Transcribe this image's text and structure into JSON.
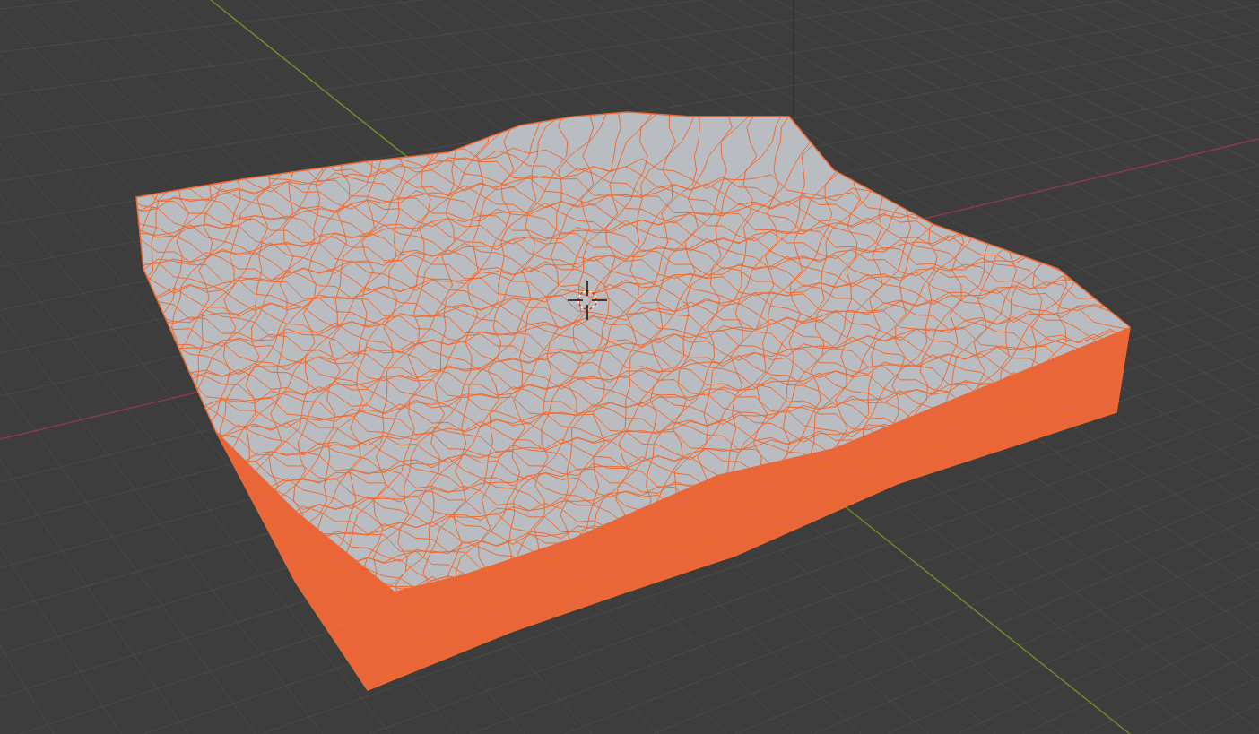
{
  "viewport": {
    "mesh": {
      "selected": true
    },
    "cursor_visible": true
  }
}
